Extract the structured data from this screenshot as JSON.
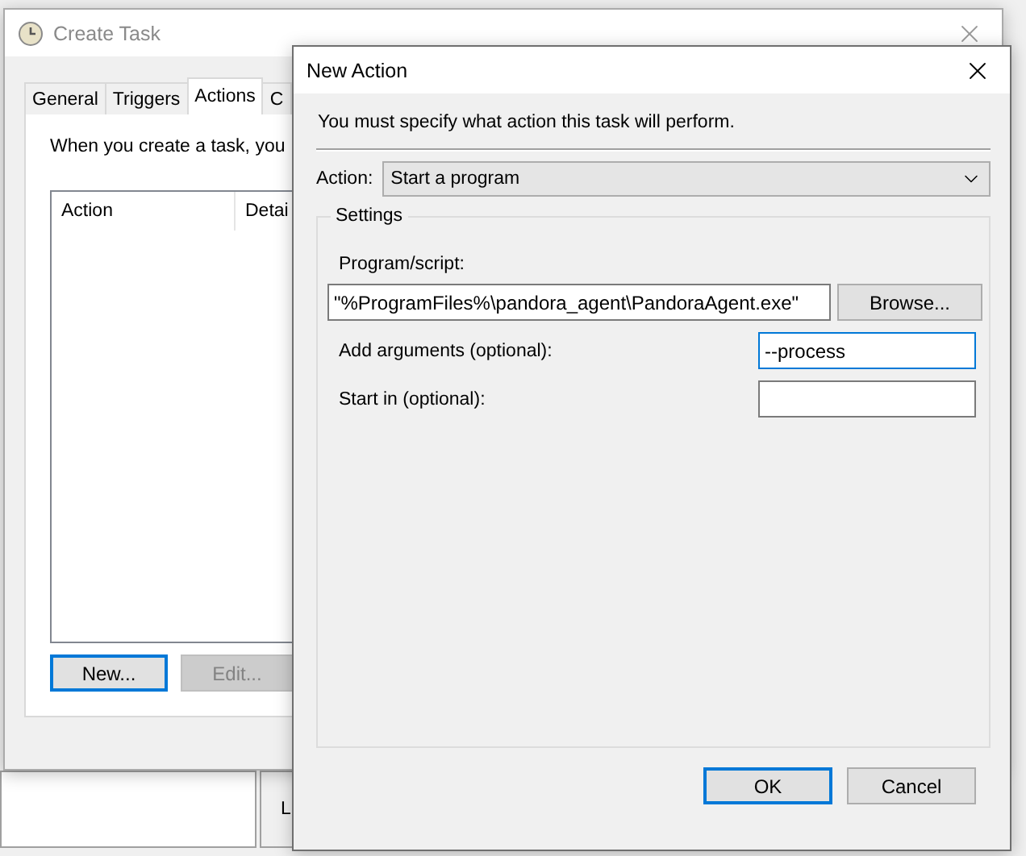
{
  "background_window": {
    "pane_label": "L"
  },
  "create_task": {
    "title": "Create Task",
    "tabs": [
      {
        "label": "General",
        "selected": false
      },
      {
        "label": "Triggers",
        "selected": false
      },
      {
        "label": "Actions",
        "selected": true
      },
      {
        "label": "C",
        "selected": false
      }
    ],
    "description": "When you create a task, you",
    "table": {
      "columns": [
        "Action",
        "Detai"
      ]
    },
    "buttons": [
      {
        "label": "New...",
        "disabled": false,
        "focused": true
      },
      {
        "label": "Edit...",
        "disabled": true,
        "focused": false
      }
    ]
  },
  "new_action": {
    "title": "New Action",
    "instruction": "You must specify what action this task will perform.",
    "action": {
      "label": "Action:",
      "value": "Start a program"
    },
    "settings": {
      "title": "Settings",
      "program": {
        "label": "Program/script:",
        "value": "\"%ProgramFiles%\\pandora_agent\\PandoraAgent.exe\"",
        "button": "Browse..."
      },
      "arguments": {
        "label": "Add arguments (optional):",
        "value": "--process",
        "focused": true
      },
      "start_in": {
        "label": "Start in (optional):",
        "focused": false
      }
    },
    "buttons": [
      {
        "label": "OK",
        "default": true
      },
      {
        "label": "Cancel",
        "default": false
      }
    ]
  }
}
